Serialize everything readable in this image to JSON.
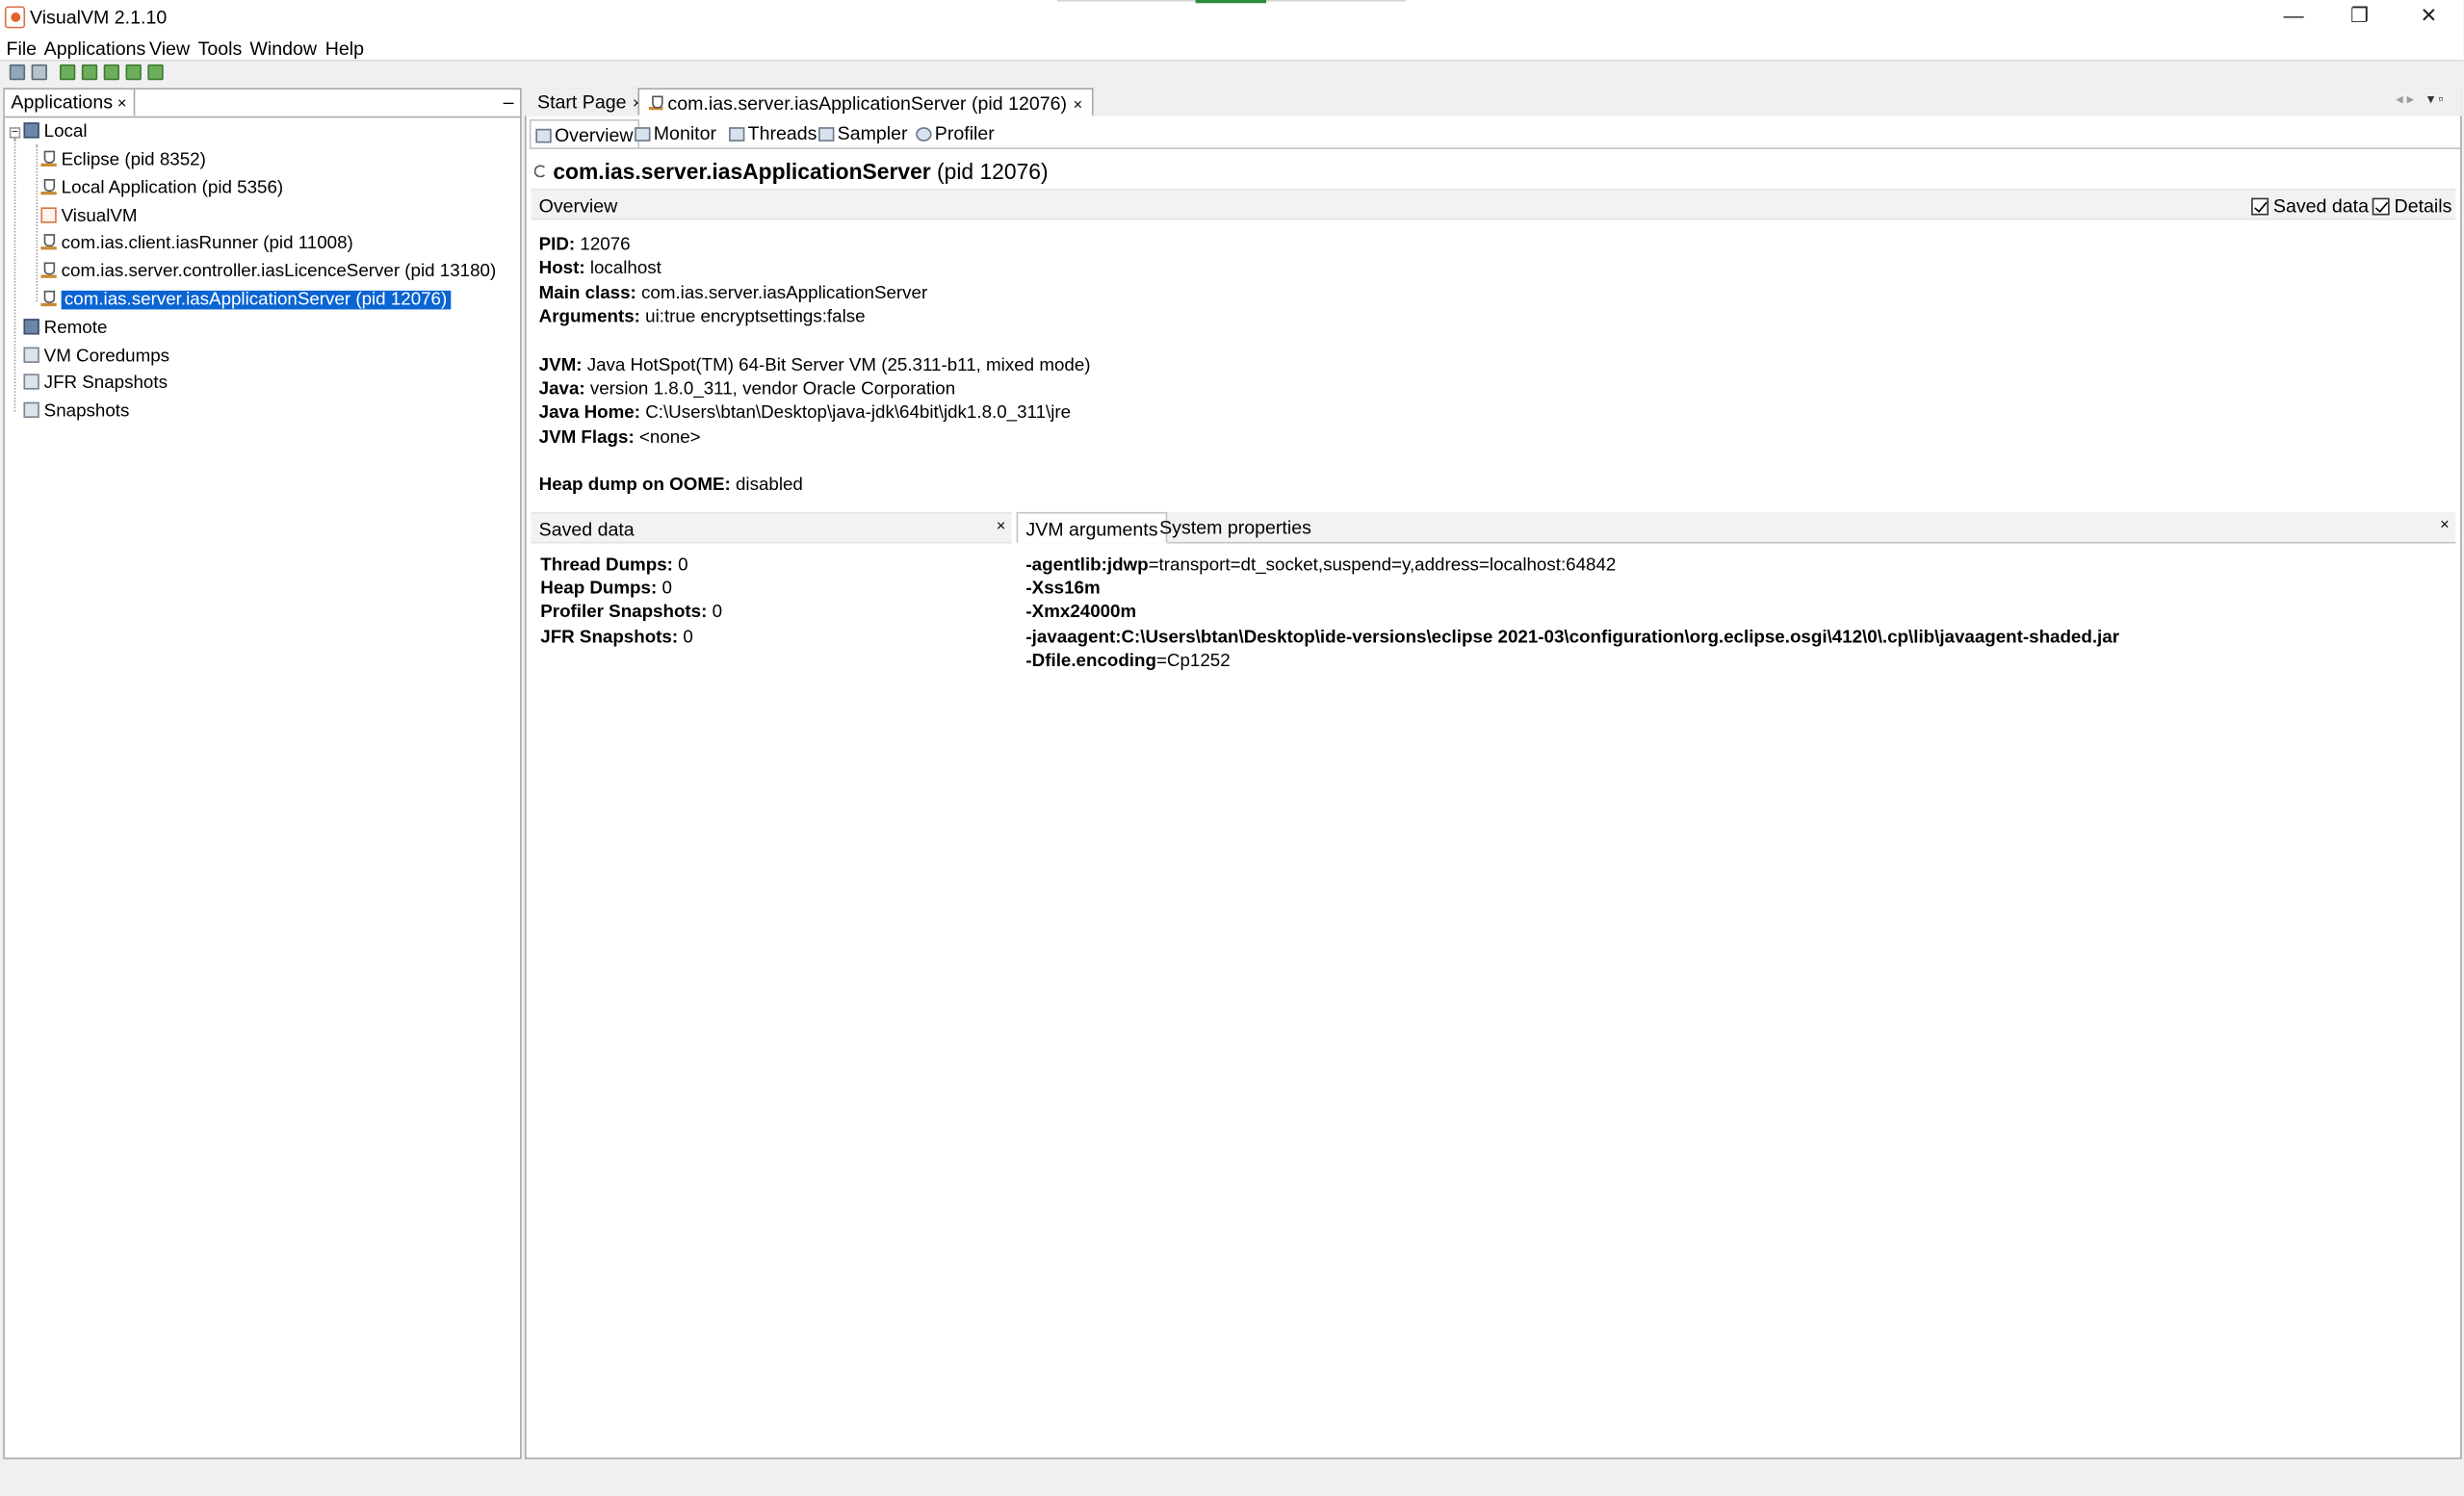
{
  "window": {
    "title": "VisualVM 2.1.10",
    "minimize": "—",
    "restore": "❐",
    "close": "✕"
  },
  "menu": [
    "File",
    "Applications",
    "View",
    "Tools",
    "Window",
    "Help"
  ],
  "left_panel": {
    "tab_label": "Applications",
    "tab_close": "×",
    "minimize": "–",
    "tree": {
      "local": "Local",
      "local_items": [
        "Eclipse (pid 8352)",
        "Local Application (pid 5356)",
        "VisualVM",
        "com.ias.client.iasRunner (pid 11008)",
        "com.ias.server.controller.iasLicenceServer (pid 13180)",
        "com.ias.server.iasApplicationServer (pid 12076)"
      ],
      "remote": "Remote",
      "coredumps": "VM Coredumps",
      "jfr": "JFR Snapshots",
      "snapshots": "Snapshots"
    }
  },
  "doc_tabs": {
    "start_page": "Start Page",
    "active": "com.ias.server.iasApplicationServer (pid 12076)",
    "close": "×"
  },
  "sub_tabs": [
    "Overview",
    "Monitor",
    "Threads",
    "Sampler",
    "Profiler"
  ],
  "main": {
    "title_bold": "com.ias.server.iasApplicationServer",
    "title_pid": "(pid 12076)",
    "section_label": "Overview",
    "chk_saved": "Saved data",
    "chk_details": "Details",
    "info": {
      "pid_label": "PID:",
      "pid": "12076",
      "host_label": "Host:",
      "host": "localhost",
      "main_class_label": "Main class:",
      "main_class": "com.ias.server.iasApplicationServer",
      "arguments_label": "Arguments:",
      "arguments": "ui:true encryptsettings:false",
      "jvm_label": "JVM:",
      "jvm": "Java HotSpot(TM) 64-Bit Server VM (25.311-b11, mixed mode)",
      "java_label": "Java:",
      "java": "version 1.8.0_311, vendor Oracle Corporation",
      "java_home_label": "Java Home:",
      "java_home": "C:\\Users\\btan\\Desktop\\java-jdk\\64bit\\jdk1.8.0_311\\jre",
      "jvm_flags_label": "JVM Flags:",
      "jvm_flags": "<none>",
      "heap_label": "Heap dump on OOME:",
      "heap": "disabled"
    },
    "saved_data": {
      "label": "Saved data",
      "close": "×",
      "thread_dumps_label": "Thread Dumps:",
      "thread_dumps": "0",
      "heap_dumps_label": "Heap Dumps:",
      "heap_dumps": "0",
      "profiler_label": "Profiler Snapshots:",
      "profiler": "0",
      "jfr_label": "JFR Snapshots:",
      "jfr": "0"
    },
    "args_tabs": {
      "jvm_args": "JVM arguments",
      "sys_props": "System properties",
      "close": "×"
    },
    "jvm_args": [
      {
        "key": "-agentlib:jdwp",
        "value": "=transport=dt_socket,suspend=y,address=localhost:64842"
      },
      {
        "key": "-Xss16m",
        "value": ""
      },
      {
        "key": "-Xmx24000m",
        "value": ""
      },
      {
        "key": "-javaagent:C:\\Users\\btan\\Desktop\\ide-versions\\eclipse 2021-03\\configuration\\org.eclipse.osgi\\412\\0\\.cp\\lib\\javaagent-shaded.jar",
        "value": ""
      },
      {
        "key": "-Dfile.encoding",
        "value": "=Cp1252"
      }
    ]
  }
}
